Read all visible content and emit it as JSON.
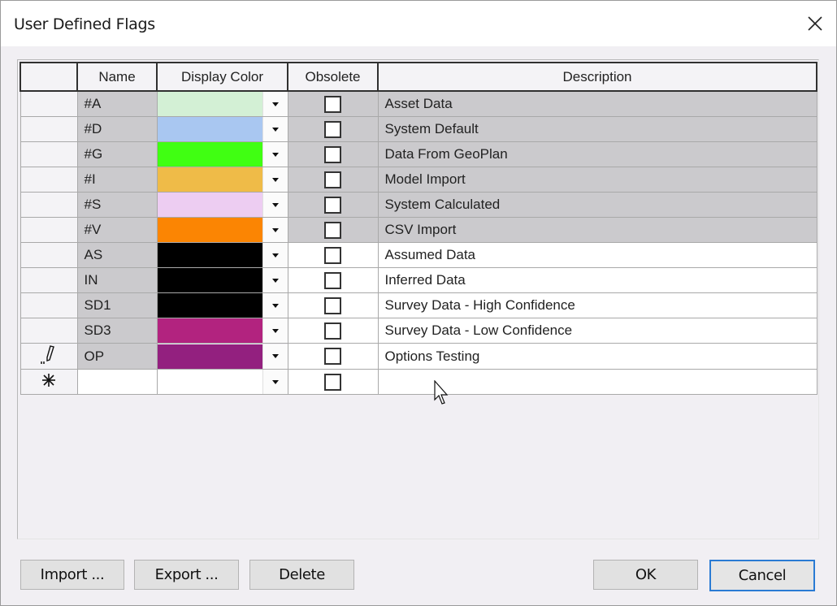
{
  "window": {
    "title": "User Defined Flags",
    "close_icon": "close-icon"
  },
  "grid": {
    "columns": [
      "",
      "Name",
      "Display Color",
      "Obsolete",
      "Description"
    ],
    "rows": [
      {
        "name": "#A",
        "color": "#d3f0d5",
        "obsolete": false,
        "description": "Asset Data",
        "system": true
      },
      {
        "name": "#D",
        "color": "#a9c7f1",
        "obsolete": false,
        "description": "System Default",
        "system": true
      },
      {
        "name": "#G",
        "color": "#40ff12",
        "obsolete": false,
        "description": "Data From GeoPlan",
        "system": true
      },
      {
        "name": "#I",
        "color": "#efbb48",
        "obsolete": false,
        "description": "Model Import",
        "system": true
      },
      {
        "name": "#S",
        "color": "#edcdf2",
        "obsolete": false,
        "description": "System Calculated",
        "system": true
      },
      {
        "name": "#V",
        "color": "#fb8503",
        "obsolete": false,
        "description": "CSV Import",
        "system": true
      },
      {
        "name": "AS",
        "color": "#000000",
        "obsolete": false,
        "description": "Assumed Data",
        "system": false
      },
      {
        "name": "IN",
        "color": "#000000",
        "obsolete": false,
        "description": "Inferred Data",
        "system": false
      },
      {
        "name": "SD1",
        "color": "#000000",
        "obsolete": false,
        "description": "Survey Data - High Confidence",
        "system": false
      },
      {
        "name": "SD3",
        "color": "#b2237f",
        "obsolete": false,
        "description": "Survey Data - Low Confidence",
        "system": false
      },
      {
        "name": "OP",
        "color": "#93207f",
        "obsolete": false,
        "description": "Options Testing",
        "system": false,
        "editing": true
      }
    ],
    "new_row": {
      "name": "",
      "color": "",
      "obsolete": false,
      "description": "",
      "indicator_icon": "new-row-asterisk-icon"
    },
    "editing_indicator_icon": "pencil-icon"
  },
  "buttons": {
    "import": "Import ...",
    "export": "Export ...",
    "delete": "Delete",
    "ok": "OK",
    "cancel": "Cancel"
  }
}
